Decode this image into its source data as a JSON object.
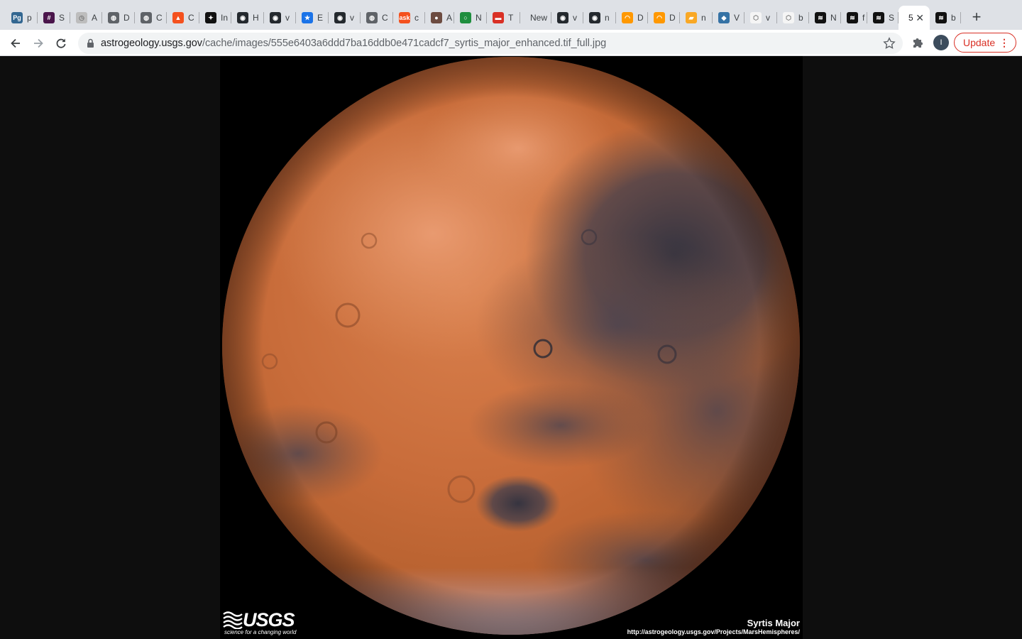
{
  "tabs": [
    {
      "fav": "Pg",
      "title": "p",
      "color": "#336791",
      "icon": "postgres-icon"
    },
    {
      "fav": "#",
      "title": "S",
      "color": "#4a154b",
      "icon": "slack-icon"
    },
    {
      "fav": "◷",
      "title": "A",
      "color": "#bdbdbd",
      "icon": "clock-icon"
    },
    {
      "fav": "◍",
      "title": "D",
      "color": "#5f6368",
      "icon": "globe-icon"
    },
    {
      "fav": "◍",
      "title": "C",
      "color": "#5f6368",
      "icon": "globe-icon"
    },
    {
      "fav": "▲",
      "title": "C",
      "color": "#f4511e",
      "icon": "fox-icon"
    },
    {
      "fav": "✦",
      "title": "In",
      "color": "#111111",
      "icon": "pentagon-icon"
    },
    {
      "fav": "◉",
      "title": "H",
      "color": "#24292e",
      "icon": "github-icon"
    },
    {
      "fav": "◉",
      "title": "v",
      "color": "#24292e",
      "icon": "github-icon"
    },
    {
      "fav": "★",
      "title": "E",
      "color": "#1a73e8",
      "icon": "star-icon"
    },
    {
      "fav": "◉",
      "title": "v",
      "color": "#24292e",
      "icon": "github-icon"
    },
    {
      "fav": "◍",
      "title": "C",
      "color": "#5f6368",
      "icon": "globe-icon"
    },
    {
      "fav": "ask",
      "title": "c",
      "color": "#f4511e",
      "icon": "ask-icon"
    },
    {
      "fav": "●",
      "title": "A",
      "color": "#6d4c41",
      "icon": "avatar-icon"
    },
    {
      "fav": "○",
      "title": "N",
      "color": "#1e8e3e",
      "icon": "ring-icon"
    },
    {
      "fav": "▬",
      "title": "T",
      "color": "#d93025",
      "icon": "flag-icon"
    },
    {
      "fav": "",
      "title": "New",
      "color": "#dee1e6",
      "icon": "blank-icon"
    },
    {
      "fav": "◉",
      "title": "v",
      "color": "#24292e",
      "icon": "github-icon"
    },
    {
      "fav": "◉",
      "title": "n",
      "color": "#24292e",
      "icon": "github-icon"
    },
    {
      "fav": "◠",
      "title": "D",
      "color": "#ff9800",
      "icon": "arc-icon"
    },
    {
      "fav": "◠",
      "title": "D",
      "color": "#ff9800",
      "icon": "arc-icon"
    },
    {
      "fav": "▰",
      "title": "n",
      "color": "#f9a825",
      "icon": "book-icon"
    },
    {
      "fav": "◆",
      "title": "V",
      "color": "#3572a5",
      "icon": "python-icon"
    },
    {
      "fav": "⬡",
      "title": "v",
      "color": "#f5f5f5",
      "icon": "hex-icon"
    },
    {
      "fav": "⬡",
      "title": "b",
      "color": "#f5f5f5",
      "icon": "hex-icon"
    },
    {
      "fav": "≋",
      "title": "N",
      "color": "#111111",
      "icon": "wave-icon"
    },
    {
      "fav": "≋",
      "title": "f",
      "color": "#111111",
      "icon": "wave-icon"
    },
    {
      "fav": "≋",
      "title": "S",
      "color": "#111111",
      "icon": "wave-icon"
    },
    {
      "fav": "",
      "title": "5",
      "color": "#ffffff",
      "icon": "blank-icon",
      "active": true
    },
    {
      "fav": "≋",
      "title": "b",
      "color": "#111111",
      "icon": "wave-icon"
    }
  ],
  "toolbar": {
    "url_host": "astrogeology.usgs.gov",
    "url_path": "/cache/images/555e6403a6ddd7ba16ddb0e471cadcf7_syrtis_major_enhanced.tif_full.jpg",
    "profile_initial": "I",
    "update_label": "Update",
    "new_tab_label": "+",
    "close_label": "✕"
  },
  "image": {
    "logo_text": "USGS",
    "logo_tagline": "science for a changing world",
    "caption_title": "Syrtis Major",
    "caption_url": "http://astrogeology.usgs.gov/Projects/MarsHemispheres/"
  },
  "colors": {
    "mars_light": "#e2875a",
    "mars_mid": "#c46a3a",
    "mars_dark": "#3b3a4a",
    "update_red": "#d93025"
  }
}
